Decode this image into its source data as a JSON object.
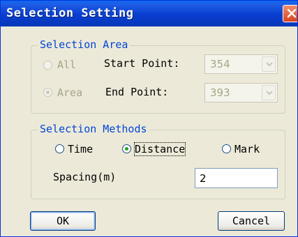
{
  "dialog": {
    "title": "Selection Setting"
  },
  "selection_area": {
    "title": "Selection Area",
    "all_label": "All",
    "area_label": "Area",
    "all_selected": false,
    "area_selected": true,
    "start_point_label": "Start Point:",
    "start_point_value": "354",
    "end_point_label": "End Point:",
    "end_point_value": "393"
  },
  "selection_methods": {
    "title": "Selection Methods",
    "options": [
      {
        "label": "Time",
        "selected": false
      },
      {
        "label": "Distance",
        "selected": true
      },
      {
        "label": "Mark",
        "selected": false
      }
    ],
    "spacing_label": "Spacing(m)",
    "spacing_value": "2"
  },
  "buttons": {
    "ok_label": "OK",
    "cancel_label": "Cancel"
  },
  "colors": {
    "titlebar": "#0a3ed0",
    "group_title": "#0046d5",
    "dialog_bg": "#ece9d8",
    "radio_dot": "#21a121",
    "close_button": "#d9431f"
  }
}
